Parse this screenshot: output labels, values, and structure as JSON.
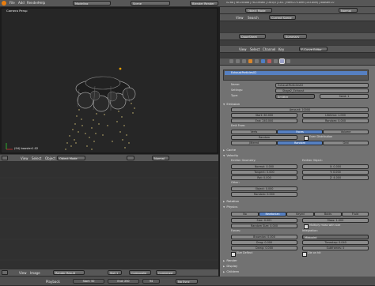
{
  "top": {
    "menu": [
      "File",
      "Add",
      "Render",
      "Help"
    ],
    "layout": "Modeling",
    "scene": "Scene",
    "engine": "Blender Render",
    "stats": "v2.68 | Ve:250488 | Fa:239460 | Ob:0/3 | La:1 | Mem:275.89M (103.80M) | booster1.0"
  },
  "viewport": {
    "label": "Camera Persp",
    "object_label": "(94) booster1.02"
  },
  "view3d_header": {
    "menu": [
      "View",
      "Select",
      "Object"
    ],
    "mode": "Object Mode",
    "shading": "Normal"
  },
  "uv_header": {
    "menu": [
      "View",
      "Image"
    ],
    "image": "Render Result",
    "slot": "Slot 1",
    "layer": "Composite",
    "pass": "Combined",
    "playback": "Playback",
    "start_label": "Start: 50",
    "end_label": "End: 250",
    "frame": "94",
    "sync": "No Sync"
  },
  "right_top": {
    "mode": "Object Mode",
    "menu": [
      "View",
      "Search"
    ],
    "search_value": "Current Scene",
    "dopesheet": "DopeSheet",
    "summary": "Summary",
    "fcurve_menu": [
      "View",
      "Select",
      "Channel",
      "Key"
    ],
    "fcurve_mode": "F-Curve Editor"
  },
  "particles": {
    "system_name": "ExhaustParticles02",
    "name_label": "Name:",
    "name_value": "ExhaustParticles02",
    "settings_label": "Settings:",
    "settings_value": "Stage2_Exhaust",
    "type_label": "Type:",
    "type_value": "Emitter",
    "seed": "Seed: 1"
  },
  "emission": {
    "title": "Emission",
    "amount": "Amount: 10000",
    "start": "Start: 60.000",
    "end": "End: 240.000",
    "lifetime": "Lifetime: 1.000",
    "random": "Random: 0.000",
    "emit_from": "Emit From:",
    "emit_opts": [
      "Verts",
      "Faces",
      "Volume"
    ],
    "random_btn": "Random",
    "even": "Even Distribution",
    "dist_opts": [
      "Jittered",
      "Random",
      "Grid"
    ]
  },
  "cache": {
    "title": "Cache"
  },
  "velocity": {
    "title": "Velocity",
    "emitter_geometry": "Emitter Geometry:",
    "emitter_object": "Emitter Object:",
    "normal": "Normal: 0.000",
    "tangent": "Tangent: 0.000",
    "rot": "Rot: 0.000",
    "ex": "X: 0.000",
    "ey": "Y: 0.000",
    "ez": "Z: 4.000",
    "other": "Other:",
    "object": "Object: 0.000",
    "random": "Random: 0.000"
  },
  "rotation": {
    "title": "Rotation"
  },
  "physics": {
    "title": "Physics",
    "types": [
      "No",
      "Newtonian",
      "Keyed",
      "Boids",
      "Fluid"
    ],
    "size": "Size: 0.001",
    "random_size": "Random Size: 0.000",
    "mass": "Mass: 1.000",
    "multiply": "Multiply mass with size",
    "forces": "Forces:",
    "integration": "Integration:",
    "brownian": "Brownian: 0.000",
    "drag": "Drag: 0.000",
    "damp": "Damp: 0.000",
    "integrator": "Midpoint",
    "timestep": "Timestep: 0.040",
    "subframes": "Subframes: 0",
    "size_deflect": "Size Deflect",
    "die_on_hit": "Die on hit"
  },
  "more_panels": [
    "Render",
    "Display",
    "Children"
  ],
  "colors": {
    "accent": "#5680c2",
    "panel": "#727272",
    "bg": "#393939"
  }
}
